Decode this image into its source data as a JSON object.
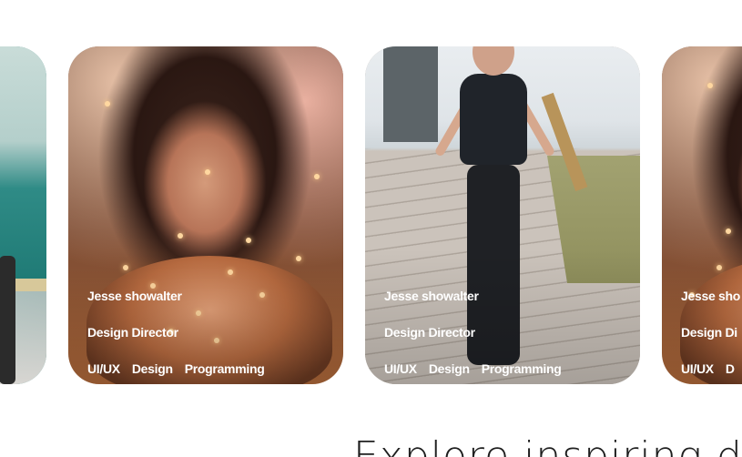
{
  "cards": [
    {
      "name": "",
      "role": "",
      "tags": [],
      "image": "street-scene"
    },
    {
      "name": "Jesse showalter",
      "role": "Design Director",
      "tags": [
        "UI/UX",
        "Design",
        "Programming"
      ],
      "image": "glitter-portrait"
    },
    {
      "name": "Jesse showalter",
      "role": "Design Director",
      "tags": [
        "UI/UX",
        "Design",
        "Programming"
      ],
      "image": "jump-rope"
    },
    {
      "name": "Jesse sho",
      "role": "Design Di",
      "tags": [
        "UI/UX",
        "D"
      ],
      "image": "glitter-portrait"
    }
  ],
  "headline": "Explore inspiring d"
}
